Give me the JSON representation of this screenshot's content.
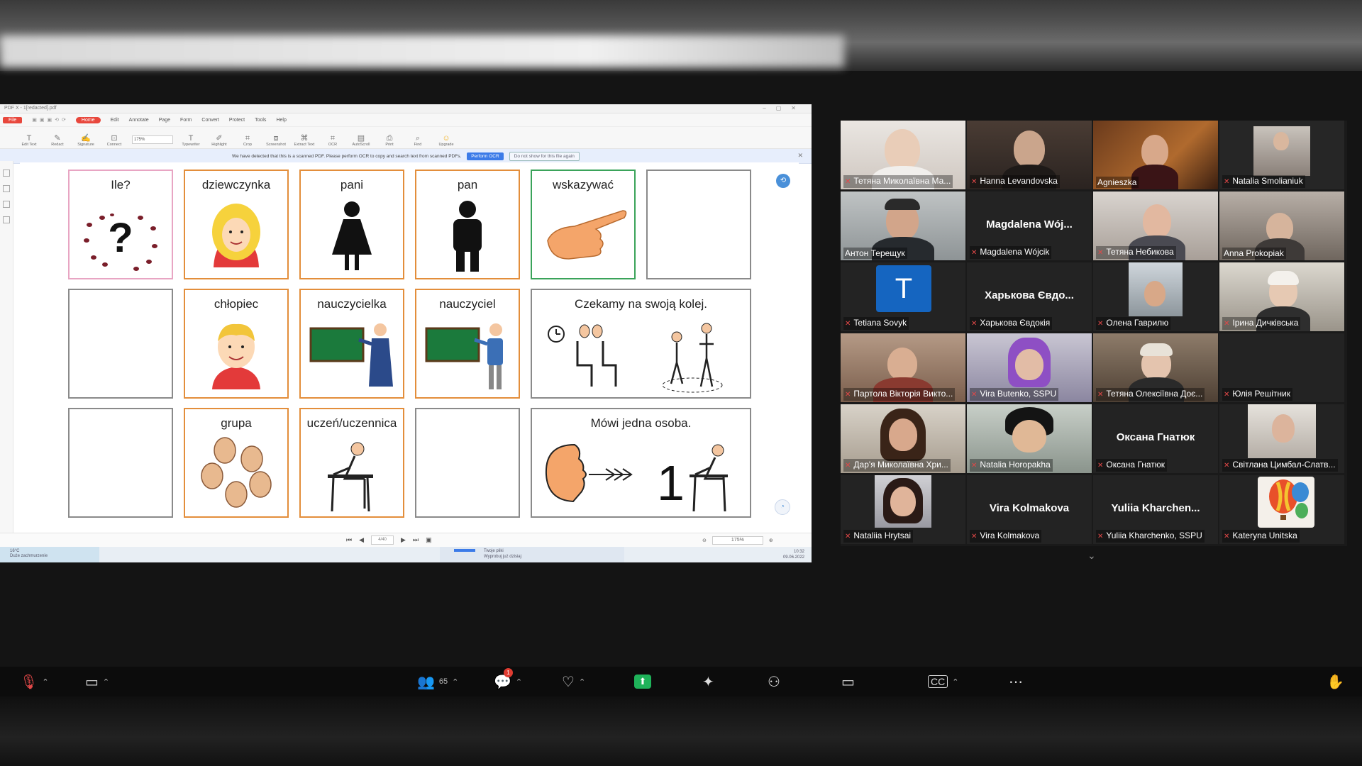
{
  "app": {
    "window_title": "PDF X - 1[redacted].pdf",
    "menu": [
      "File",
      "Home",
      "Edit",
      "Annotate",
      "Page",
      "Form",
      "Convert",
      "Protect",
      "Tools",
      "Help"
    ],
    "tools": [
      {
        "label": "Edit Text",
        "icon": "T"
      },
      {
        "label": "Redact",
        "icon": "✎"
      },
      {
        "label": "Signature",
        "icon": "✍"
      },
      {
        "label": "Connect",
        "icon": "⊡"
      },
      {
        "label": "Typewriter",
        "icon": "T"
      },
      {
        "label": "Highlight",
        "icon": "✐"
      },
      {
        "label": "Crop",
        "icon": "⌗"
      },
      {
        "label": "Screenshot",
        "icon": "⧈"
      },
      {
        "label": "Extract Text",
        "icon": "⌘"
      },
      {
        "label": "OCR",
        "icon": "⌗"
      },
      {
        "label": "AutoScroll",
        "icon": "▤"
      },
      {
        "label": "Print",
        "icon": "⎙"
      },
      {
        "label": "Find",
        "icon": "⌕"
      },
      {
        "label": "Upgrade",
        "icon": "☺"
      }
    ],
    "zoom_value": "175%",
    "ocr_banner": {
      "message": "We have detected that this is a scanned PDF. Please perform OCR to copy and search text from scanned PDFs.",
      "perform_btn": "Perform OCR",
      "dismiss_btn": "Do not show for this file again"
    },
    "page_field": "4/40",
    "zoom_footer": "175%",
    "taskbar": {
      "weather_temp": "16°C",
      "weather_desc": "Duże zachmurzenie",
      "notice_title": "Twoje pliki",
      "notice_sub": "Wyprobuj już dzisiaj",
      "time": "10:32",
      "date": "09.06.2022"
    }
  },
  "cards": {
    "r1c1": "Ile?",
    "r1c2": "dziewczynka",
    "r1c3": "pani",
    "r1c4": "pan",
    "r1c5": "wskazywać",
    "r2c2": "chłopiec",
    "r2c3": "nauczycielka",
    "r2c4": "nauczyciel",
    "r2c5": "Czekamy na swoją kolej.",
    "r3c2": "grupa",
    "r3c3": "uczeń/uczennica",
    "r3c5": "Mówi jedna osoba."
  },
  "participants": [
    "Тетяна Миколаївна Ма...",
    "Hanna Levandovska",
    "Agnieszka",
    "Natalia Smolianiuk",
    "Антон Терещук",
    "Magdalena Wójcik",
    "Тетяна Небикова",
    "Anna Prokopiak",
    "Tetiana Sovyk",
    "Харькова Євдокія",
    "Олена Гаврилю",
    "Ірина Дичківська",
    "Партола Вікторія Викто...",
    "Vira Butenko, SSPU",
    "Тетяна Олексіївна Доє...",
    "Юлія Решітник",
    "Дар'я Миколаївна Хри...",
    "Natalia Horopakha",
    "Оксана Гнатюк",
    "Світлана Цимбал-Слатв...",
    "Nataliia Hrytsai",
    "Vira Kolmakova",
    "Yuliia Kharchenko, SSPU",
    "Kateryna Unitska"
  ],
  "big_names": {
    "magdalena": "Magdalena Wój...",
    "kharkova": "Харькова Євдо...",
    "oksana": "Оксана Гнатюк",
    "vira": "Vira Kolmakova",
    "yuliia": "Yuliia Kharchen..."
  },
  "avatar_letter": "T",
  "controls": {
    "participants_count": "65",
    "chat_badge": "1"
  },
  "colors": {
    "card_orange": "#e38e3b",
    "card_pink": "#e8a5c3",
    "card_green": "#3aa35a",
    "active_speaker": "#3ad45c",
    "share_green": "#1fb35a",
    "app_red": "#e8473c"
  }
}
